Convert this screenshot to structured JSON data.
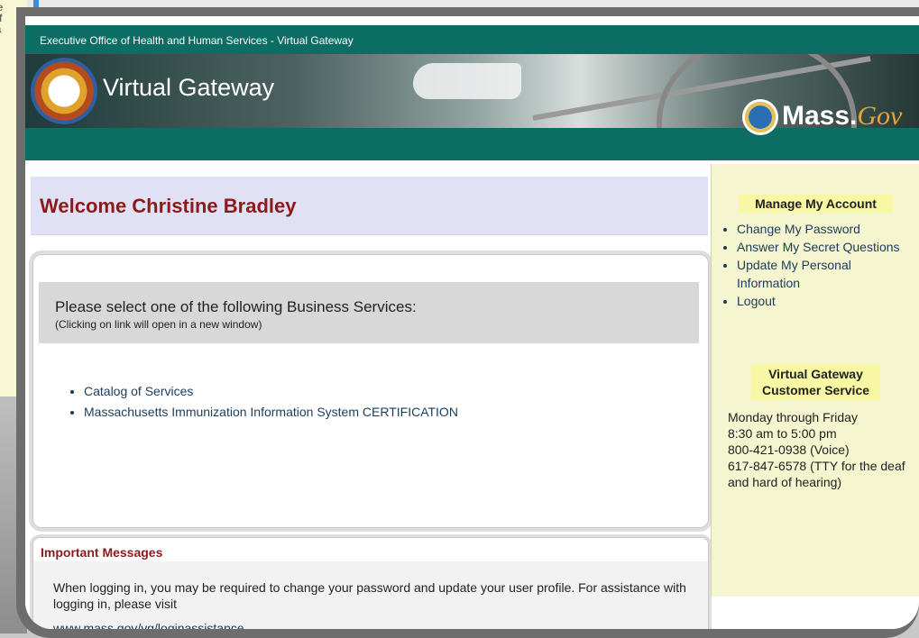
{
  "background_window": {
    "text_lines": [
      "ice",
      "Y f",
      "ea"
    ]
  },
  "header": {
    "topbar_text": "Executive Office of Health and Human Services - Virtual Gateway",
    "banner_title": "Virtual Gateway",
    "brand_text_mass": "Mass.",
    "brand_text_gov": "Gov"
  },
  "welcome": {
    "title": "Welcome Christine Bradley"
  },
  "services": {
    "prompt": "Please select one of the following Business Services:",
    "note": "(Clicking on link will open in a new window)",
    "items": [
      "Catalog of Services",
      "Massachusetts Immunization Information System CERTIFICATION"
    ]
  },
  "messages": {
    "heading": "Important Messages",
    "body": "When logging in, you may be required to change your password and update your user profile. For assistance with logging in, please visit",
    "link": "www.mass.gov/vg/loginassistance."
  },
  "sidebar": {
    "account_heading": "Manage My Account",
    "account_links": [
      "Change My Password",
      "Answer My Secret Questions",
      "Update My Personal Information",
      "Logout"
    ],
    "cs_heading_line1": "Virtual Gateway",
    "cs_heading_line2": "Customer Service",
    "cs_lines": [
      "Monday through Friday",
      "8:30 am to 5:00 pm",
      "800-421-0938 (Voice)",
      "617-847-6578 (TTY for the deaf and hard of hearing)"
    ]
  },
  "colors": {
    "teal": "#0b6d64",
    "heading_red": "#8b1a1a",
    "link_blue": "#1a3c5c",
    "sidebar_bg": "#f5f5cf"
  }
}
